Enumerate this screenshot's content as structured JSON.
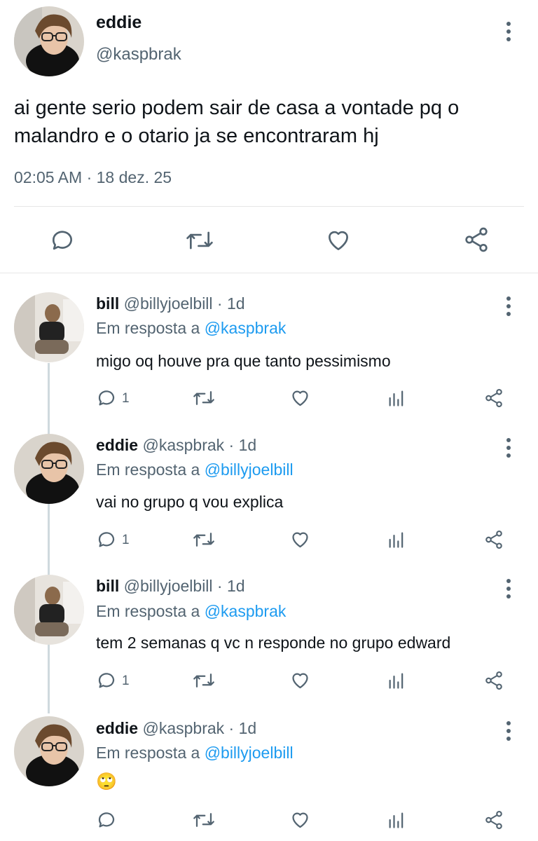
{
  "main_tweet": {
    "name": "eddie",
    "handle": "@kaspbrak",
    "text": "ai gente serio podem sair de casa a vontade pq o malandro e o otario ja se encontraram hj",
    "time": "02:05 AM",
    "sep": "·",
    "date": "18 dez. 25"
  },
  "replies": [
    {
      "name": "bill",
      "handle": "@billyjoelbill",
      "sep": "·",
      "age": "1d",
      "reply_prefix": "Em resposta a",
      "reply_to": "@kaspbrak",
      "text": "migo oq houve pra que tanto pessimismo",
      "reply_count": "1"
    },
    {
      "name": "eddie",
      "handle": "@kaspbrak",
      "sep": "·",
      "age": "1d",
      "reply_prefix": "Em resposta a",
      "reply_to": "@billyjoelbill",
      "text": "vai no grupo q vou explica",
      "reply_count": "1"
    },
    {
      "name": "bill",
      "handle": "@billyjoelbill",
      "sep": "·",
      "age": "1d",
      "reply_prefix": "Em resposta a",
      "reply_to": "@kaspbrak",
      "text": "tem 2 semanas q vc n responde no grupo edward",
      "reply_count": "1"
    },
    {
      "name": "eddie",
      "handle": "@kaspbrak",
      "sep": "·",
      "age": "1d",
      "reply_prefix": "Em resposta a",
      "reply_to": "@billyjoelbill",
      "text": "🙄",
      "reply_count": ""
    }
  ],
  "icons": {
    "reply": "reply-icon",
    "retweet": "retweet-icon",
    "like": "heart-icon",
    "views": "views-icon",
    "share": "share-icon",
    "more": "more-icon"
  },
  "colors": {
    "link": "#1d9bf0",
    "muted": "#536471",
    "divider": "#e6e6e6"
  }
}
